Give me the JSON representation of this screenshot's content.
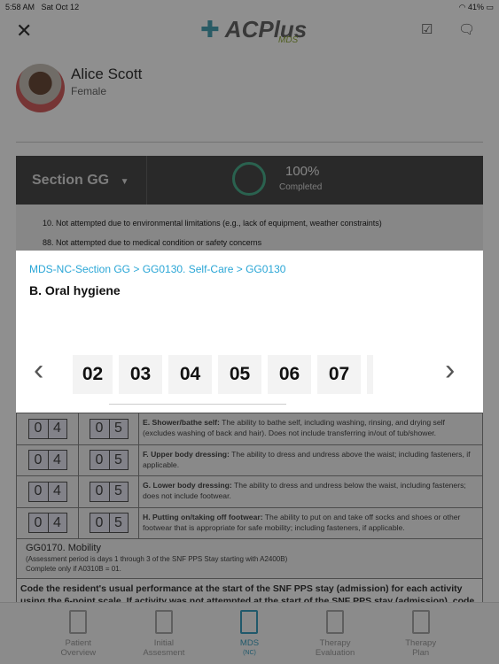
{
  "status": {
    "time": "5:58 AM",
    "date": "Sat Oct 12",
    "battery": "41%"
  },
  "header": {
    "logo": "ACPlus",
    "logo_sub": "MDS"
  },
  "patient": {
    "name": "Alice  Scott",
    "gender": "Female"
  },
  "section": {
    "label": "Section GG",
    "progress": "100%",
    "progress_label": "Completed"
  },
  "options": [
    "10. Not attempted due to environmental limitations (e.g., lack of equipment, weather constraints)",
    "88. Not attempted due to medical condition or safety concerns"
  ],
  "modal": {
    "breadcrumb": "MDS-NC-Section GG > GG0130. Self-Care > GG0130",
    "question": "B. Oral hygiene",
    "choices": [
      "02",
      "03",
      "04",
      "05",
      "06",
      "07"
    ]
  },
  "rows": [
    {
      "a": [
        "0",
        "4"
      ],
      "b": [
        "0",
        "5"
      ],
      "title": "E. Shower/bathe self:",
      "text": " The ability to bathe self, including washing, rinsing, and drying self (excludes washing of back and hair). Does not include transferring in/out of tub/shower."
    },
    {
      "a": [
        "0",
        "4"
      ],
      "b": [
        "0",
        "5"
      ],
      "title": "F. Upper body dressing:",
      "text": " The ability to dress and undress above the waist; including fasteners, if applicable."
    },
    {
      "a": [
        "0",
        "4"
      ],
      "b": [
        "0",
        "5"
      ],
      "title": "G. Lower body dressing:",
      "text": " The ability to dress and undress below the waist, including fasteners; does not include footwear."
    },
    {
      "a": [
        "0",
        "4"
      ],
      "b": [
        "0",
        "5"
      ],
      "title": "H. Putting on/taking off footwear:",
      "text": " The ability to put on and take off socks and shoes or other footwear that is appropriate for safe mobility; including fasteners, if applicable."
    }
  ],
  "mobility": {
    "title": "GG0170. Mobility",
    "line1": "(Assessment period is days 1 through 3 of the SNF PPS Stay starting with A2400B)",
    "line2": "Complete only if A0310B = 01."
  },
  "instructions": "Code the resident's usual performance at the start of the SNF PPS stay (admission) for each activity using the 6-point scale. If activity was not attempted at the start of the SNF PPS stay (admission), code",
  "tabs": [
    {
      "label": "Patient",
      "label2": "Overview"
    },
    {
      "label": "Initial",
      "label2": "Assesment"
    },
    {
      "label": "MDS",
      "label2": "(NC)"
    },
    {
      "label": "Therapy",
      "label2": "Evaluation"
    },
    {
      "label": "Therapy",
      "label2": "Plan"
    }
  ],
  "colors": {
    "accent": "#2aa6d6",
    "progress": "#4caf8e"
  }
}
